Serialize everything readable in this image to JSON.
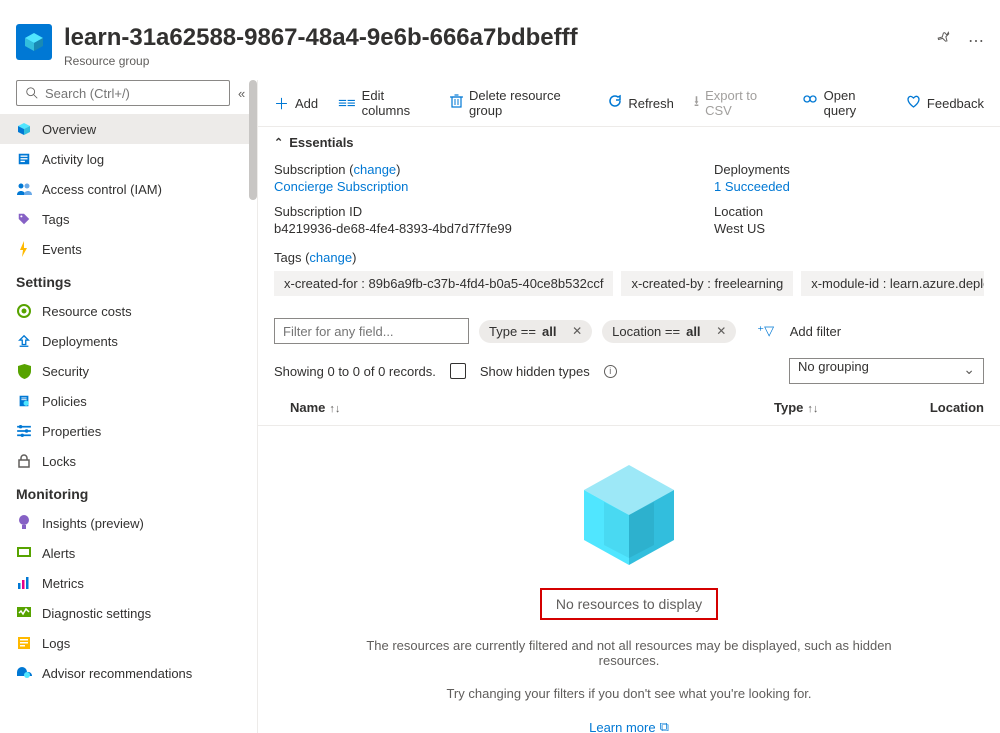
{
  "header": {
    "title": "learn-31a62588-9867-48a4-9e6b-666a7bdbefff",
    "subtitle": "Resource group"
  },
  "search": {
    "placeholder": "Search (Ctrl+/)"
  },
  "sidebar": {
    "items_top": [
      {
        "label": "Overview",
        "icon": "cube-icon"
      },
      {
        "label": "Activity log",
        "icon": "log-icon"
      },
      {
        "label": "Access control (IAM)",
        "icon": "people-icon"
      },
      {
        "label": "Tags",
        "icon": "tag-icon"
      },
      {
        "label": "Events",
        "icon": "events-icon"
      }
    ],
    "section_settings": "Settings",
    "items_settings": [
      {
        "label": "Resource costs",
        "icon": "cost-icon"
      },
      {
        "label": "Deployments",
        "icon": "deploy-icon"
      },
      {
        "label": "Security",
        "icon": "security-icon"
      },
      {
        "label": "Policies",
        "icon": "policy-icon"
      },
      {
        "label": "Properties",
        "icon": "properties-icon"
      },
      {
        "label": "Locks",
        "icon": "lock-icon"
      }
    ],
    "section_monitoring": "Monitoring",
    "items_monitoring": [
      {
        "label": "Insights (preview)",
        "icon": "insights-icon"
      },
      {
        "label": "Alerts",
        "icon": "alerts-icon"
      },
      {
        "label": "Metrics",
        "icon": "metrics-icon"
      },
      {
        "label": "Diagnostic settings",
        "icon": "diag-icon"
      },
      {
        "label": "Logs",
        "icon": "logs-icon"
      },
      {
        "label": "Advisor recommendations",
        "icon": "advisor-icon"
      }
    ]
  },
  "toolbar": {
    "add": "Add",
    "edit_columns": "Edit columns",
    "delete": "Delete resource group",
    "refresh": "Refresh",
    "export_csv": "Export to CSV",
    "open_query": "Open query",
    "feedback": "Feedback"
  },
  "essentials": {
    "title": "Essentials",
    "subscription_label": "Subscription",
    "change_label": "change",
    "subscription_value": "Concierge Subscription",
    "subscription_id_label": "Subscription ID",
    "subscription_id_value": "b4219936-de68-4fe4-8393-4bd7d7f7fe99",
    "deployments_label": "Deployments",
    "deployments_value": "1 Succeeded",
    "location_label": "Location",
    "location_value": "West US",
    "tags_label": "Tags",
    "tags": [
      "x-created-for : 89b6a9fb-c37b-4fd4-b0a5-40ce8b532ccf",
      "x-created-by : freelearning",
      "x-module-id : learn.azure.deploy-az"
    ]
  },
  "filter": {
    "placeholder": "Filter for any field...",
    "type_prefix": "Type == ",
    "type_value": "all",
    "location_prefix": "Location == ",
    "location_value": "all",
    "add_filter": "Add filter"
  },
  "status": {
    "showing": "Showing 0 to 0 of 0 records.",
    "hidden_types": "Show hidden types",
    "grouping": "No grouping"
  },
  "table": {
    "col_name": "Name",
    "col_type": "Type",
    "col_location": "Location"
  },
  "empty": {
    "title": "No resources to display",
    "line1": "The resources are currently filtered and not all resources may be displayed, such as hidden resources.",
    "line2": "Try changing your filters if you don't see what you're looking for.",
    "learn_more": "Learn more"
  }
}
